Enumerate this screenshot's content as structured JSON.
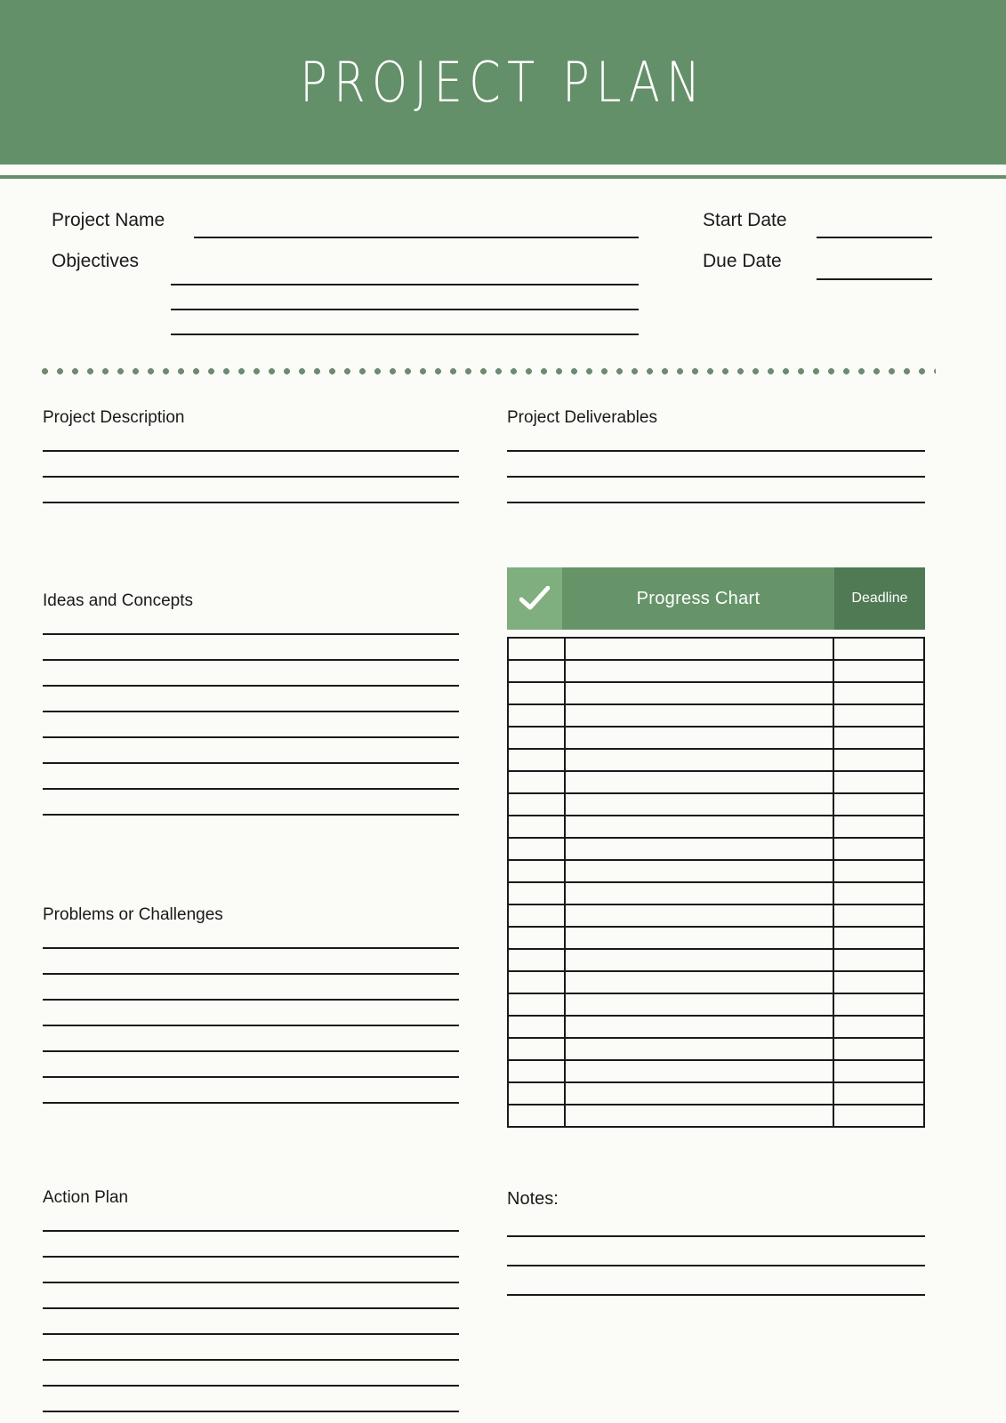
{
  "document": {
    "title": "PROJECT PLAN",
    "accent_green": "#649069",
    "light_green": "#7fae7f",
    "mid_green": "#669468",
    "dark_green": "#4f7a53",
    "dot_color": "#6d8a72",
    "background": "#fbfcf8",
    "rule_color": "#1a1a1a"
  },
  "top_fields": {
    "project_name": {
      "label": "Project Name",
      "value": "",
      "line_count": 1
    },
    "objectives": {
      "label": "Objectives",
      "value": "",
      "line_count": 3
    },
    "start_date": {
      "label": "Start Date",
      "value": "",
      "line_count": 1
    },
    "due_date": {
      "label": "Due Date",
      "value": "",
      "line_count": 1
    }
  },
  "left_column": {
    "sections": [
      {
        "title": "Project Description",
        "line_count": 3
      },
      {
        "title": "Ideas and Concepts",
        "line_count": 8
      },
      {
        "title": "Problems or Challenges",
        "line_count": 7
      },
      {
        "title": "Action Plan",
        "line_count": 8
      }
    ]
  },
  "right_column": {
    "deliverables": {
      "title": "Project Deliverables",
      "line_count": 3
    },
    "progress_chart": {
      "check_icon": "check-icon",
      "title": "Progress Chart",
      "deadline_label": "Deadline",
      "columns": [
        "",
        "Progress Chart",
        "Deadline"
      ],
      "row_count": 22,
      "rows": [
        [
          "",
          "",
          ""
        ],
        [
          "",
          "",
          ""
        ],
        [
          "",
          "",
          ""
        ],
        [
          "",
          "",
          ""
        ],
        [
          "",
          "",
          ""
        ],
        [
          "",
          "",
          ""
        ],
        [
          "",
          "",
          ""
        ],
        [
          "",
          "",
          ""
        ],
        [
          "",
          "",
          ""
        ],
        [
          "",
          "",
          ""
        ],
        [
          "",
          "",
          ""
        ],
        [
          "",
          "",
          ""
        ],
        [
          "",
          "",
          ""
        ],
        [
          "",
          "",
          ""
        ],
        [
          "",
          "",
          ""
        ],
        [
          "",
          "",
          ""
        ],
        [
          "",
          "",
          ""
        ],
        [
          "",
          "",
          ""
        ],
        [
          "",
          "",
          ""
        ],
        [
          "",
          "",
          ""
        ],
        [
          "",
          "",
          ""
        ],
        [
          "",
          "",
          ""
        ]
      ]
    },
    "notes": {
      "title": "Notes:",
      "line_count": 3
    }
  }
}
